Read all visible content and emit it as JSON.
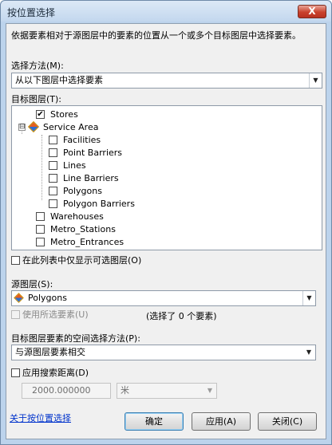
{
  "window": {
    "title": "按位置选择",
    "close_label": "X"
  },
  "description": "依据要素相对于源图层中的要素的位置从一个或多个目标图层中选择要素。",
  "selection_method": {
    "label": "选择方法(M):",
    "value": "从以下图层中选择要素"
  },
  "target_layers": {
    "label": "目标图层(T):",
    "items": [
      {
        "label": "Stores",
        "checked": true
      },
      {
        "label": "Service Area",
        "expander": "⊟"
      },
      {
        "label": "Facilities",
        "checked": false
      },
      {
        "label": "Point Barriers",
        "checked": false
      },
      {
        "label": "Lines",
        "checked": false
      },
      {
        "label": "Line Barriers",
        "checked": false
      },
      {
        "label": "Polygons",
        "checked": false
      },
      {
        "label": "Polygon Barriers",
        "checked": false
      },
      {
        "label": "Warehouses",
        "checked": false
      },
      {
        "label": "Metro_Stations",
        "checked": false
      },
      {
        "label": "Metro_Entrances",
        "checked": false
      }
    ]
  },
  "only_selectable": {
    "label": "在此列表中仅显示可选图层(O)",
    "checked": false
  },
  "source_layer": {
    "label": "源图层(S):",
    "value": "Polygons"
  },
  "use_selected": {
    "label": "使用所选要素(U)",
    "checked": false,
    "count_text": "(选择了 0 个要素)"
  },
  "spatial_method": {
    "label": "目标图层要素的空间选择方法(P):",
    "value": "与源图层要素相交"
  },
  "search_distance": {
    "label": "应用搜索距离(D)",
    "checked": false,
    "value": "2000.000000",
    "unit": "米"
  },
  "footer": {
    "link": "关于按位置选择",
    "ok": "确定",
    "apply": "应用(A)",
    "close": "关闭(C)"
  },
  "colors": {
    "title_bar": "#c3d7ee",
    "close_button": "#c9412d",
    "link": "#0033cc"
  }
}
